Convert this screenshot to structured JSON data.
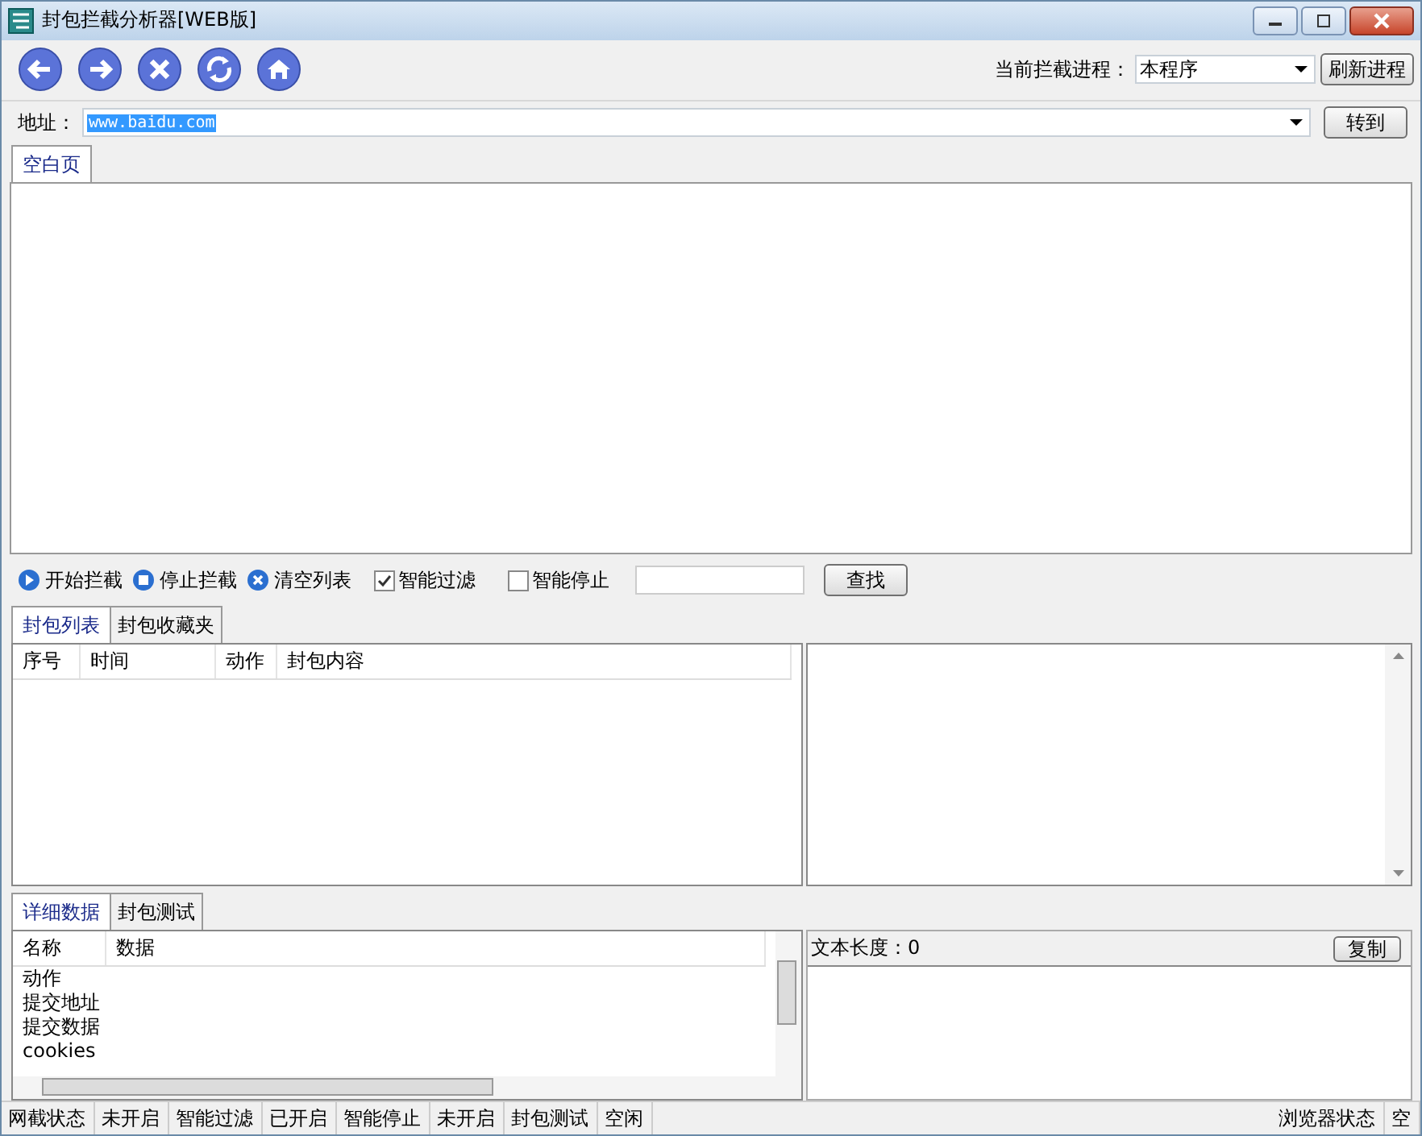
{
  "window": {
    "title": "封包拦截分析器[WEB版]"
  },
  "process": {
    "label": "当前拦截进程：",
    "value": "本程序",
    "button": "刷新进程"
  },
  "address": {
    "label": "地址：",
    "value": "www.baidu.com",
    "text_selected": true,
    "button": "转到"
  },
  "browser_tabs": [
    {
      "label": "空白页",
      "selected": true
    }
  ],
  "capture_actions": [
    {
      "kind": "start",
      "label": "开始拦截"
    },
    {
      "kind": "stop",
      "label": "停止拦截"
    },
    {
      "kind": "clear",
      "label": "清空列表"
    }
  ],
  "options": [
    {
      "label": "智能过滤",
      "checked": true
    },
    {
      "label": "智能停止",
      "checked": false
    }
  ],
  "find_button": "查找",
  "packet_tabs": [
    {
      "label": "封包列表",
      "selected": true
    },
    {
      "label": "封包收藏夹",
      "selected": false
    }
  ],
  "packet_table": {
    "columns": [
      "序号",
      "时间",
      "动作",
      "封包内容"
    ]
  },
  "detail_tabs": [
    {
      "label": "详细数据",
      "selected": true
    },
    {
      "label": "封包测试",
      "selected": false
    }
  ],
  "detail_table": {
    "columns": [
      "名称",
      "数据"
    ],
    "rows": [
      "动作",
      "提交地址",
      "提交数据",
      "cookies"
    ]
  },
  "text_length": "文本长度：0",
  "copy_button": "复制",
  "status_bar": {
    "left": [
      "网截状态",
      "未开启",
      "智能过滤",
      "已开启",
      "智能停止",
      "未开启",
      "封包测试",
      "空闲"
    ],
    "right": [
      "浏览器状态",
      "空"
    ]
  }
}
